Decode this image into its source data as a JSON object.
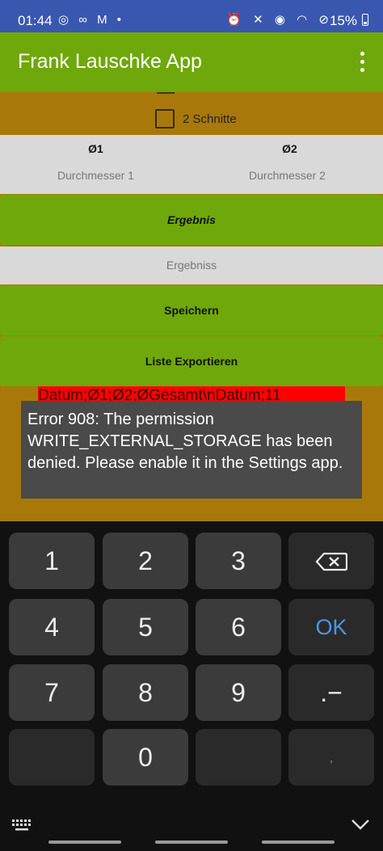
{
  "status_bar": {
    "time": "01:44",
    "left_icons": "◎ ∞ M •",
    "right_icons": "⏰ ✕ ◉ ◠ ⊘",
    "battery": "15%"
  },
  "app_bar": {
    "title": "Frank Lauschke App"
  },
  "form": {
    "checkbox_label": "2 Schnitte",
    "diameter_1_header": "Ø1",
    "diameter_2_header": "Ø2",
    "diameter_1_placeholder": "Durchmesser 1",
    "diameter_2_placeholder": "Durchmesser 2",
    "ergebnis_button": "Ergebnis",
    "ergebnis_field": "Ergebniss",
    "save_button": "Speichern",
    "export_button": "Liste Exportieren",
    "export_preview": "Datum;Ø1;Ø2;ØGesamt\\nDatum;11"
  },
  "toast": {
    "message": "Error 908: The permission WRITE_EXTERNAL_STORAGE has been denied. Please enable it in the Settings app."
  },
  "keyboard": {
    "keys": [
      "1",
      "2",
      "3",
      "4",
      "5",
      "6",
      "7",
      "8",
      "9",
      "0"
    ],
    "ok_label": "OK",
    "symbol_key": ".−",
    "comma_key": ","
  },
  "colors": {
    "status_bar": "#3a57b0",
    "app_bar": "#6fa80a",
    "content_bg": "#a8790a",
    "field_bg": "#d9d9d9",
    "error_strip": "#ff0000",
    "toast_bg": "#4a4a4a",
    "keyboard_bg": "#111111",
    "ok_accent": "#4a96e8"
  }
}
